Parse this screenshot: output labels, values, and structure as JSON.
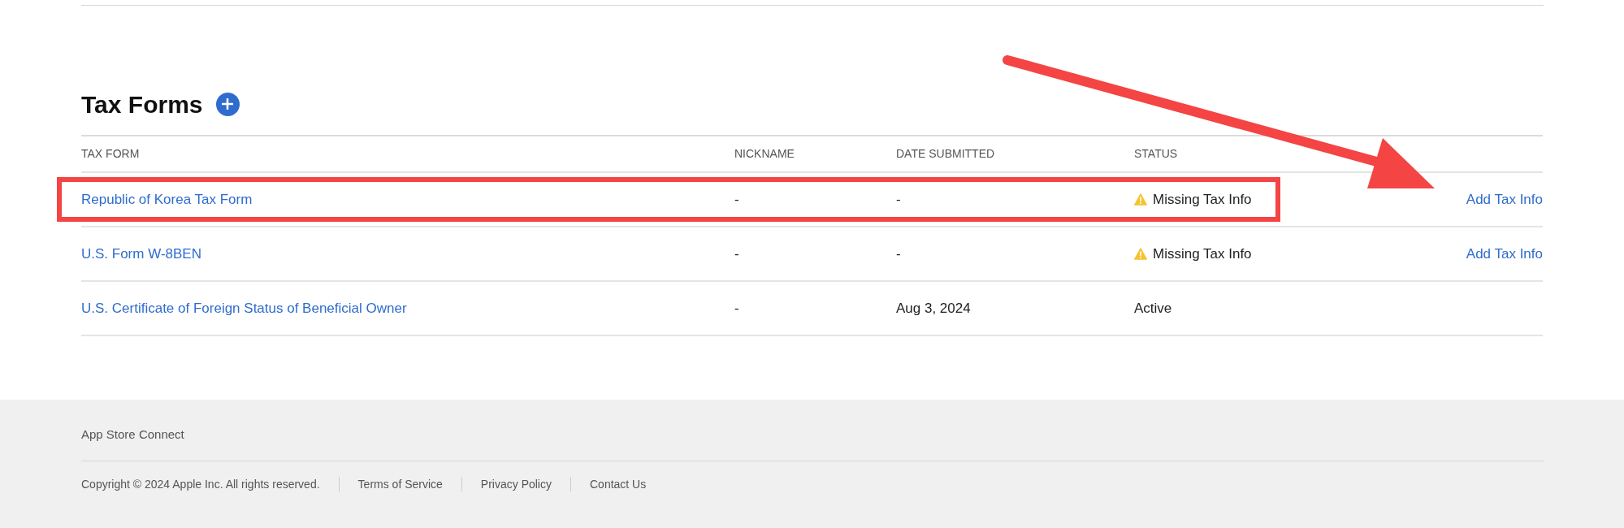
{
  "section": {
    "title": "Tax Forms"
  },
  "table": {
    "columns": [
      "TAX FORM",
      "NICKNAME",
      "DATE SUBMITTED",
      "STATUS"
    ],
    "rows": [
      {
        "form": "Republic of Korea Tax Form",
        "nickname": "-",
        "date": "-",
        "status": "Missing Tax Info",
        "warning": true,
        "action": "Add Tax Info",
        "highlighted": true
      },
      {
        "form": "U.S. Form W-8BEN",
        "nickname": "-",
        "date": "-",
        "status": "Missing Tax Info",
        "warning": true,
        "action": "Add Tax Info",
        "highlighted": false
      },
      {
        "form": "U.S. Certificate of Foreign Status of Beneficial Owner",
        "nickname": "-",
        "date": "Aug 3, 2024",
        "status": "Active",
        "warning": false,
        "highlighted": false
      }
    ]
  },
  "footer": {
    "brand": "App Store Connect",
    "copyright": "Copyright © 2024 Apple Inc. All rights reserved.",
    "links": [
      "Terms of Service",
      "Privacy Policy",
      "Contact Us"
    ]
  }
}
